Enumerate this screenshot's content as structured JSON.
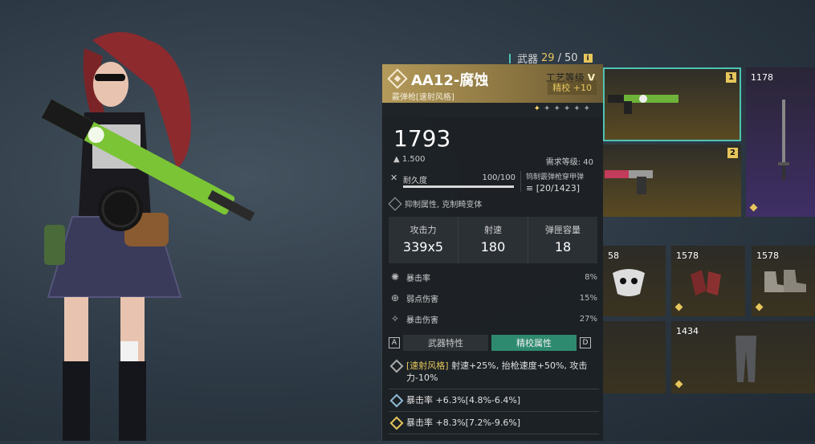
{
  "header": {
    "label": "武器",
    "count_current": "29",
    "count_sep": "/",
    "count_max": "50",
    "info_icon": "i"
  },
  "weapon": {
    "name": "AA12-腐蚀",
    "subtitle": "霰弹枪[速射风格]",
    "craft_label": "工艺等级",
    "craft_grade": "V",
    "stars_total": 6,
    "stars_lit": 1,
    "refine_label": "精校 +10",
    "power": "1793",
    "weight": "1.500",
    "required_level": "需求等级: 40",
    "durability_label": "耐久度",
    "durability_value": "100/100",
    "durability_fraction": 1.0,
    "ammo_type": "钨制霰弹枪穿甲弹",
    "ammo_count": "[20/1423]",
    "feature": "抑制属性, 克制畸变体",
    "main_stats": [
      {
        "label": "攻击力",
        "value": "339x5"
      },
      {
        "label": "射速",
        "value": "180"
      },
      {
        "label": "弹匣容量",
        "value": "18"
      }
    ],
    "sub_stats": [
      {
        "label": "暴击率",
        "value": "8%"
      },
      {
        "label": "弱点伤害",
        "value": "15%"
      },
      {
        "label": "暴击伤害",
        "value": "27%"
      }
    ],
    "tab_key_left": "A",
    "tab_key_right": "D",
    "tabs": [
      "武器特性",
      "精校属性"
    ],
    "active_tab": "精校属性",
    "attributes": [
      {
        "tag": "[速射风格]",
        "text": " 射速+25%, 抬枪速度+50%, 攻击力-10%"
      },
      {
        "tag": "",
        "text": "暴击率 +6.3%[4.8%-6.4%]"
      },
      {
        "tag": "",
        "text": "暴击率 +8.3%[7.2%-9.6%]"
      }
    ]
  },
  "inventory": {
    "slots": [
      {
        "label": "",
        "badge": "1",
        "icon": "green-shotgun-icon"
      },
      {
        "label": "1178",
        "badge": "",
        "icon": "sword-icon"
      },
      {
        "label": "",
        "badge": "2",
        "icon": "pistol-icon"
      },
      {
        "label": "58",
        "badge": "",
        "icon": "mask-icon"
      },
      {
        "label": "1578",
        "badge": "",
        "icon": "gloves-icon"
      },
      {
        "label": "1578",
        "badge": "",
        "icon": "boots-icon"
      },
      {
        "label": "1434",
        "badge": "",
        "icon": "pants-icon"
      }
    ]
  }
}
